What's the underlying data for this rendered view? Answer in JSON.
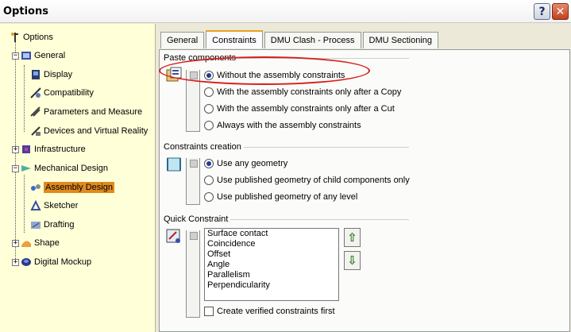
{
  "window": {
    "title": "Options",
    "help_label": "?",
    "close_label": "✕"
  },
  "tree": {
    "items": [
      {
        "label": "Options",
        "icon": "options-icon"
      },
      {
        "label": "General",
        "icon": "general-icon"
      },
      {
        "label": "Display",
        "icon": "display-icon"
      },
      {
        "label": "Compatibility",
        "icon": "compatibility-icon"
      },
      {
        "label": "Parameters and Measure",
        "icon": "parameters-icon"
      },
      {
        "label": "Devices and Virtual Reality",
        "icon": "devices-icon"
      },
      {
        "label": "Infrastructure",
        "icon": "infrastructure-icon"
      },
      {
        "label": "Mechanical Design",
        "icon": "mechanical-design-icon"
      },
      {
        "label": "Assembly Design",
        "icon": "assembly-design-icon"
      },
      {
        "label": "Sketcher",
        "icon": "sketcher-icon"
      },
      {
        "label": "Drafting",
        "icon": "drafting-icon"
      },
      {
        "label": "Shape",
        "icon": "shape-icon"
      },
      {
        "label": "Digital Mockup",
        "icon": "digital-mockup-icon"
      }
    ],
    "selected": "Assembly Design"
  },
  "tabs": [
    {
      "label": "General"
    },
    {
      "label": "Constraints"
    },
    {
      "label": "DMU Clash - Process"
    },
    {
      "label": "DMU Sectioning"
    }
  ],
  "active_tab": "Constraints",
  "paste_components": {
    "title": "Paste components",
    "options": [
      {
        "label": "Without the assembly constraints",
        "checked": true
      },
      {
        "label": "With the assembly constraints only after a Copy",
        "checked": false
      },
      {
        "label": "With the assembly constraints only after a Cut",
        "checked": false
      },
      {
        "label": "Always with the assembly constraints",
        "checked": false
      }
    ]
  },
  "constraints_creation": {
    "title": "Constraints creation",
    "options": [
      {
        "label": "Use any geometry",
        "checked": true
      },
      {
        "label": "Use published geometry of child components only",
        "checked": false
      },
      {
        "label": "Use published geometry of any level",
        "checked": false
      }
    ]
  },
  "quick_constraint": {
    "title": "Quick Constraint",
    "list": [
      "Surface contact",
      "Coincidence",
      "Offset",
      "Angle",
      "Parallelism",
      "Perpendicularity"
    ],
    "up_label": "⇧",
    "down_label": "⇩",
    "checkbox_label": "Create verified constraints first",
    "checkbox_checked": false
  },
  "colors": {
    "selection": "#e08a1e",
    "tree_bg": "#ffffd8",
    "annotation": "#d4201c",
    "radio_dot": "#1d3b9a"
  }
}
